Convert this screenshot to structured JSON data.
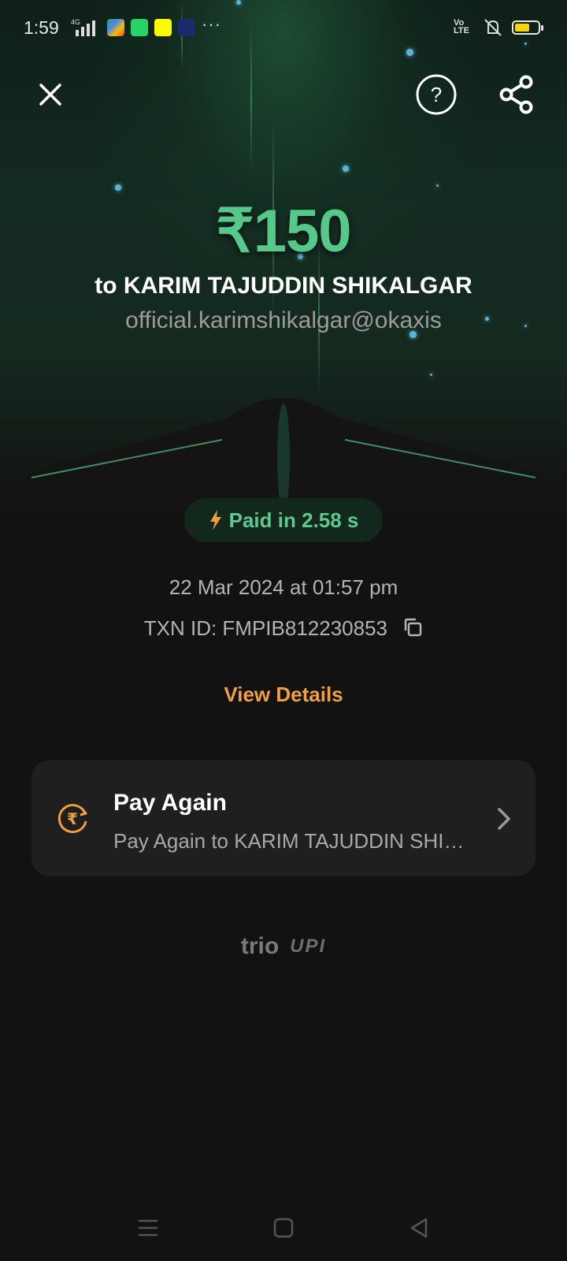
{
  "status_bar": {
    "time": "1:59",
    "network": "4G",
    "volte": "Vo LTE",
    "more": "···",
    "battery_level": 0.65,
    "icons": [
      "signal-icon",
      "google-play-games-icon",
      "whatsapp-icon",
      "snapchat-icon",
      "news-app-icon",
      "mute-icon",
      "battery-icon"
    ]
  },
  "header": {
    "close_icon": "close-icon",
    "help_icon": "help-icon",
    "share_icon": "share-icon"
  },
  "payment": {
    "amount": "₹150",
    "to_name": "to KARIM TAJUDDIN SHIKALGAR",
    "upi_id": "official.karimshikalgar@okaxis",
    "paid_badge": "Paid in 2.58 s",
    "datetime": "22 Mar 2024 at 01:57 pm",
    "txn_id": "TXN ID: FMPIB812230853",
    "view_details": "View Details"
  },
  "pay_again": {
    "title": "Pay Again",
    "subtitle": "Pay Again to KARIM TAJUDDIN SHIKALGAR"
  },
  "footer": {
    "brand": "trio",
    "upi": "UPI"
  },
  "colors": {
    "amount": "#56c98a",
    "accent_orange": "#f2a03d",
    "background": "#121212",
    "card": "#1f1f1f"
  }
}
